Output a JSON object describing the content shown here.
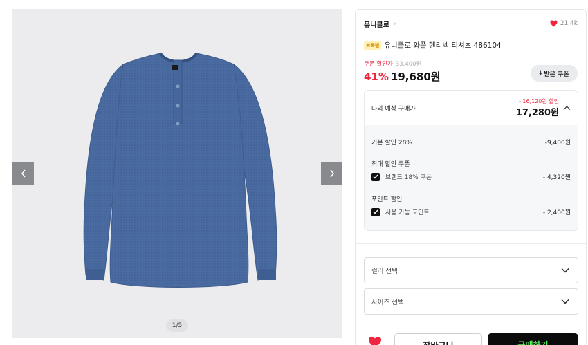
{
  "gallery": {
    "pager": "1/5"
  },
  "product": {
    "brand": "유니클로",
    "likes": "21.4k",
    "tag": "⌘특별",
    "name": "유니클로 와플 헨리넥 티셔츠 486104",
    "coupon_label": "쿠폰 할인가",
    "original_price": "33,400원",
    "discount_rate": "41%",
    "price": "19,680원",
    "coupon_button": "받은 쿠폰"
  },
  "estimate": {
    "label": "나의 예상 구매가",
    "saving": "- 16,120원 할인",
    "price": "17,280원",
    "base_discount_label": "기본 할인 28%",
    "base_discount_value": "-9,400원",
    "coupon_section": "최대 할인 쿠폰",
    "coupon_item": "브랜드 18% 쿠폰",
    "coupon_value": "- 4,320원",
    "point_section": "포인트 할인",
    "point_item": "사용 가능 포인트",
    "point_value": "- 2,400원"
  },
  "options": {
    "color_placeholder": "컬러 선택",
    "size_placeholder": "사이즈 선택"
  },
  "actions": {
    "cart": "장바구니",
    "buy": "구매하기"
  },
  "colors": {
    "accent_red": "#f0263f",
    "buy_text": "#52f25a",
    "shirt": "#4a6b9f"
  }
}
